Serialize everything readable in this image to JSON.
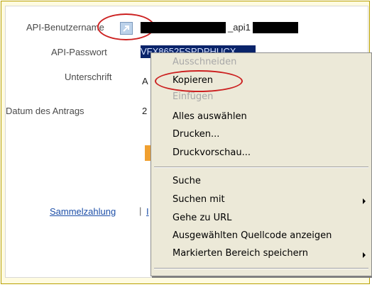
{
  "form": {
    "username_label": "API-Benutzername",
    "username_suffix": "_api1",
    "password_label": "API-Passwort",
    "password_partial": "VFX8652FSPDPHUCX",
    "signature_label": "Unterschrift",
    "signature_partial": "A",
    "date_label": "Datum des Antrags",
    "date_partial": "2"
  },
  "links": {
    "bulk_payment": "Sammelzahlung",
    "separator": "|",
    "next_partial": "I"
  },
  "context_menu": {
    "items": [
      {
        "label": "Ausschneiden",
        "disabled": true
      },
      {
        "label": "Kopieren",
        "disabled": false
      },
      {
        "label": "Einfügen",
        "disabled": true
      },
      {
        "label": "Alles auswählen",
        "disabled": false
      },
      {
        "label": "Drucken...",
        "disabled": false
      },
      {
        "label": "Druckvorschau...",
        "disabled": false
      },
      {
        "label": "Suche",
        "disabled": false
      },
      {
        "label": "Suchen mit",
        "disabled": false,
        "submenu": true
      },
      {
        "label": "Gehe zu URL",
        "disabled": false
      },
      {
        "label": "Ausgewählten Quellcode anzeigen",
        "disabled": false
      },
      {
        "label": "Markierten Bereich speichern",
        "disabled": false,
        "submenu": true
      }
    ]
  },
  "colors": {
    "highlight_circle": "#cc2020",
    "selection_bg": "#0a246a",
    "menu_bg": "#ece9d8",
    "orange_button": "#f0a030",
    "frame_bg": "#fffbe0"
  }
}
